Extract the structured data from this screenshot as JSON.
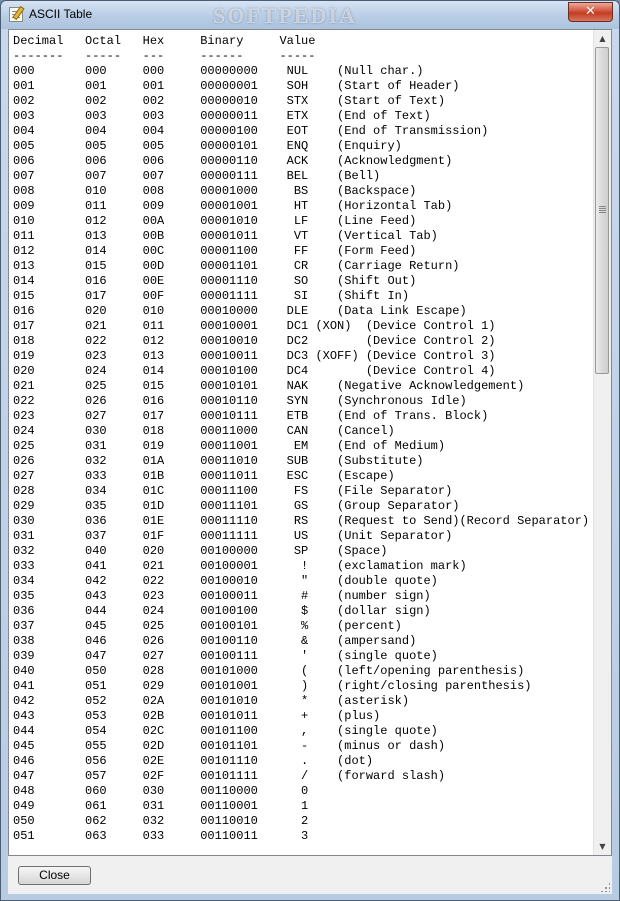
{
  "window": {
    "title": "ASCII Table",
    "watermark": "SOFTPEDIA",
    "close_glyph": "✕"
  },
  "table": {
    "rows": [
      "Decimal   Octal   Hex     Binary     Value",
      "-------   -----   ---     ------     -----",
      "000       000     000     00000000    NUL    (Null char.)",
      "001       001     001     00000001    SOH    (Start of Header)",
      "002       002     002     00000010    STX    (Start of Text)",
      "003       003     003     00000011    ETX    (End of Text)",
      "004       004     004     00000100    EOT    (End of Transmission)",
      "005       005     005     00000101    ENQ    (Enquiry)",
      "006       006     006     00000110    ACK    (Acknowledgment)",
      "007       007     007     00000111    BEL    (Bell)",
      "008       010     008     00001000     BS    (Backspace)",
      "009       011     009     00001001     HT    (Horizontal Tab)",
      "010       012     00A     00001010     LF    (Line Feed)",
      "011       013     00B     00001011     VT    (Vertical Tab)",
      "012       014     00C     00001100     FF    (Form Feed)",
      "013       015     00D     00001101     CR    (Carriage Return)",
      "014       016     00E     00001110     SO    (Shift Out)",
      "015       017     00F     00001111     SI    (Shift In)",
      "016       020     010     00010000    DLE    (Data Link Escape)",
      "017       021     011     00010001    DC1 (XON)  (Device Control 1)",
      "018       022     012     00010010    DC2        (Device Control 2)",
      "019       023     013     00010011    DC3 (XOFF) (Device Control 3)",
      "020       024     014     00010100    DC4        (Device Control 4)",
      "021       025     015     00010101    NAK    (Negative Acknowledgement)",
      "022       026     016     00010110    SYN    (Synchronous Idle)",
      "023       027     017     00010111    ETB    (End of Trans. Block)",
      "024       030     018     00011000    CAN    (Cancel)",
      "025       031     019     00011001     EM    (End of Medium)",
      "026       032     01A     00011010    SUB    (Substitute)",
      "027       033     01B     00011011    ESC    (Escape)",
      "028       034     01C     00011100     FS    (File Separator)",
      "029       035     01D     00011101     GS    (Group Separator)",
      "030       036     01E     00011110     RS    (Request to Send)(Record Separator)",
      "031       037     01F     00011111     US    (Unit Separator)",
      "032       040     020     00100000     SP    (Space)",
      "033       041     021     00100001      !    (exclamation mark)",
      "034       042     022     00100010      \"    (double quote)",
      "035       043     023     00100011      #    (number sign)",
      "036       044     024     00100100      $    (dollar sign)",
      "037       045     025     00100101      %    (percent)",
      "038       046     026     00100110      &    (ampersand)",
      "039       047     027     00100111      '    (single quote)",
      "040       050     028     00101000      (    (left/opening parenthesis)",
      "041       051     029     00101001      )    (right/closing parenthesis)",
      "042       052     02A     00101010      *    (asterisk)",
      "043       053     02B     00101011      +    (plus)",
      "044       054     02C     00101100      ,    (single quote)",
      "045       055     02D     00101101      -    (minus or dash)",
      "046       056     02E     00101110      .    (dot)",
      "047       057     02F     00101111      /    (forward slash)",
      "048       060     030     00110000      0",
      "049       061     031     00110001      1",
      "050       062     032     00110010      2",
      "051       063     033     00110011      3"
    ]
  },
  "scrollbar": {
    "up_glyph": "▲",
    "down_glyph": "▼"
  },
  "footer": {
    "close_label": "Close"
  }
}
